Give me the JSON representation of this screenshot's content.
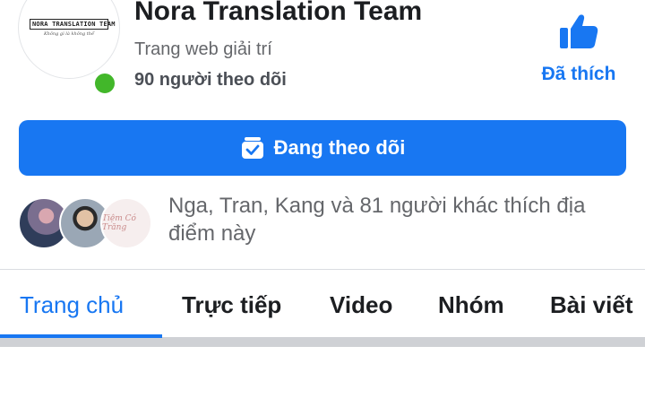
{
  "header": {
    "page_name": "Nora Translation Team",
    "category": "Trang web giải trí",
    "followers": "90 người theo dõi",
    "logo_text": "NORA TRANSLATION TEAM",
    "logo_tagline": "Không gì là không thể",
    "like_label": "Đã thích",
    "like_icon": "thumbs-up-icon",
    "online_color": "#42b72a"
  },
  "follow_button": {
    "label": "Đang theo dõi",
    "icon": "following-check-icon",
    "color": "#1877f2"
  },
  "friends": {
    "text": "Nga, Tran, Kang và 81 người khác thích địa điểm này",
    "avatar_3_text": "Tiệm Có Trăng"
  },
  "tabs": [
    {
      "label": "Trang chủ",
      "active": true
    },
    {
      "label": "Trực tiếp",
      "active": false
    },
    {
      "label": "Video",
      "active": false
    },
    {
      "label": "Nhóm",
      "active": false
    },
    {
      "label": "Bài viết",
      "active": false
    }
  ],
  "accent_color": "#1877f2"
}
